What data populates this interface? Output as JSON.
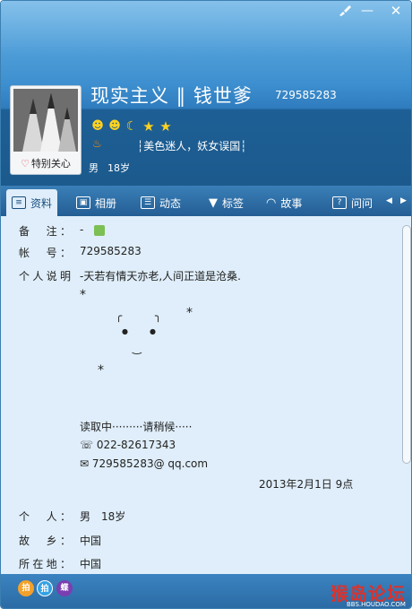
{
  "window": {
    "controls": {
      "skin_icon": "brush-icon",
      "minimize": "—",
      "close": "✕"
    }
  },
  "header": {
    "nickname": "现实主义 ‖ 钱世爹",
    "qq_number": "729585283",
    "avatar_follow_label": "特别关心",
    "badges": [
      "sun",
      "sun",
      "moon",
      "star",
      "star"
    ],
    "signature": "┆美色迷人，妖女误国┆",
    "gender": "男",
    "age": "18岁"
  },
  "tabs": [
    {
      "label": "资料",
      "icon": "id-card-icon",
      "active": true
    },
    {
      "label": "相册",
      "icon": "photo-icon",
      "active": false
    },
    {
      "label": "动态",
      "icon": "list-icon",
      "active": false
    },
    {
      "label": "标签",
      "icon": "bookmark-icon",
      "active": false
    },
    {
      "label": "故事",
      "icon": "rainbow-icon",
      "active": false
    },
    {
      "label": "问问",
      "icon": "question-icon",
      "active": false
    }
  ],
  "profile": {
    "remark_label": "备　注：",
    "remark_value": "-",
    "account_label": "帐　号：",
    "account_value": "729585283",
    "desc_label": "个人说明",
    "desc_line1": "-天若有情天亦老,人间正道是沧桑.",
    "art_star1": "*",
    "art_star2": "*",
    "art_star3": "*",
    "art_brow_left": "╭",
    "art_brow_right": "╮",
    "art_eye_left": "●",
    "art_eye_right": "●",
    "art_mouth": "‿",
    "loading": "读取中·········请稍候·····",
    "phone": "☏ 022-82617343",
    "email": "✉ 729585283@ qq.com",
    "date": "2013年2月1日 9点",
    "person_label": "个　人：",
    "person_value": "男　18岁",
    "hometown_label": "故　乡：",
    "hometown_value": "中国",
    "location_label": "所在地：",
    "location_value": "中国"
  },
  "footer": {
    "icons": [
      "拍",
      "拍",
      "蝶"
    ],
    "watermark": "猴岛论坛",
    "watermark_url": "BBS.HOUDAO.COM"
  }
}
